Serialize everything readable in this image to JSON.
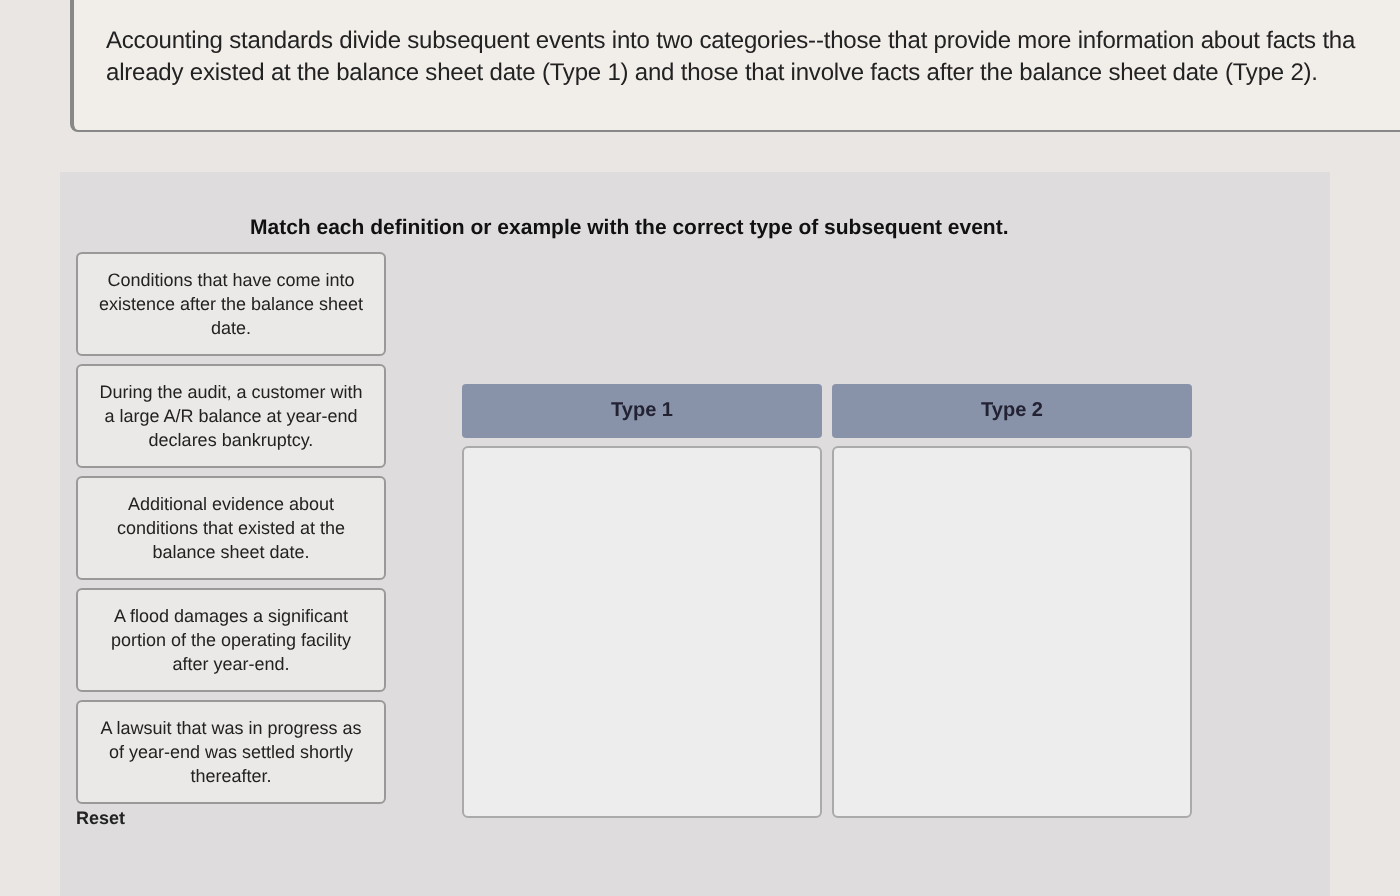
{
  "intro": "Accounting standards divide subsequent events into two categories--those that provide more information about facts tha",
  "intro_line2": "already existed at the balance sheet date (Type 1) and those that involve facts after the balance sheet date (Type 2).",
  "instruction": "Match each definition or example with the correct type of subsequent event.",
  "cards": [
    {
      "text": "Conditions that have come into existence after the balance sheet date."
    },
    {
      "text": "During the audit, a customer with a large A/R balance at year-end declares bankruptcy."
    },
    {
      "text": "Additional evidence about conditions that existed at the balance sheet date."
    },
    {
      "text": "A flood damages a significant portion of the operating facility after year-end."
    },
    {
      "text": "A lawsuit that was in progress as of year-end was settled shortly thereafter."
    }
  ],
  "reset": "Reset",
  "targets": [
    {
      "label": "Type 1"
    },
    {
      "label": "Type 2"
    }
  ]
}
